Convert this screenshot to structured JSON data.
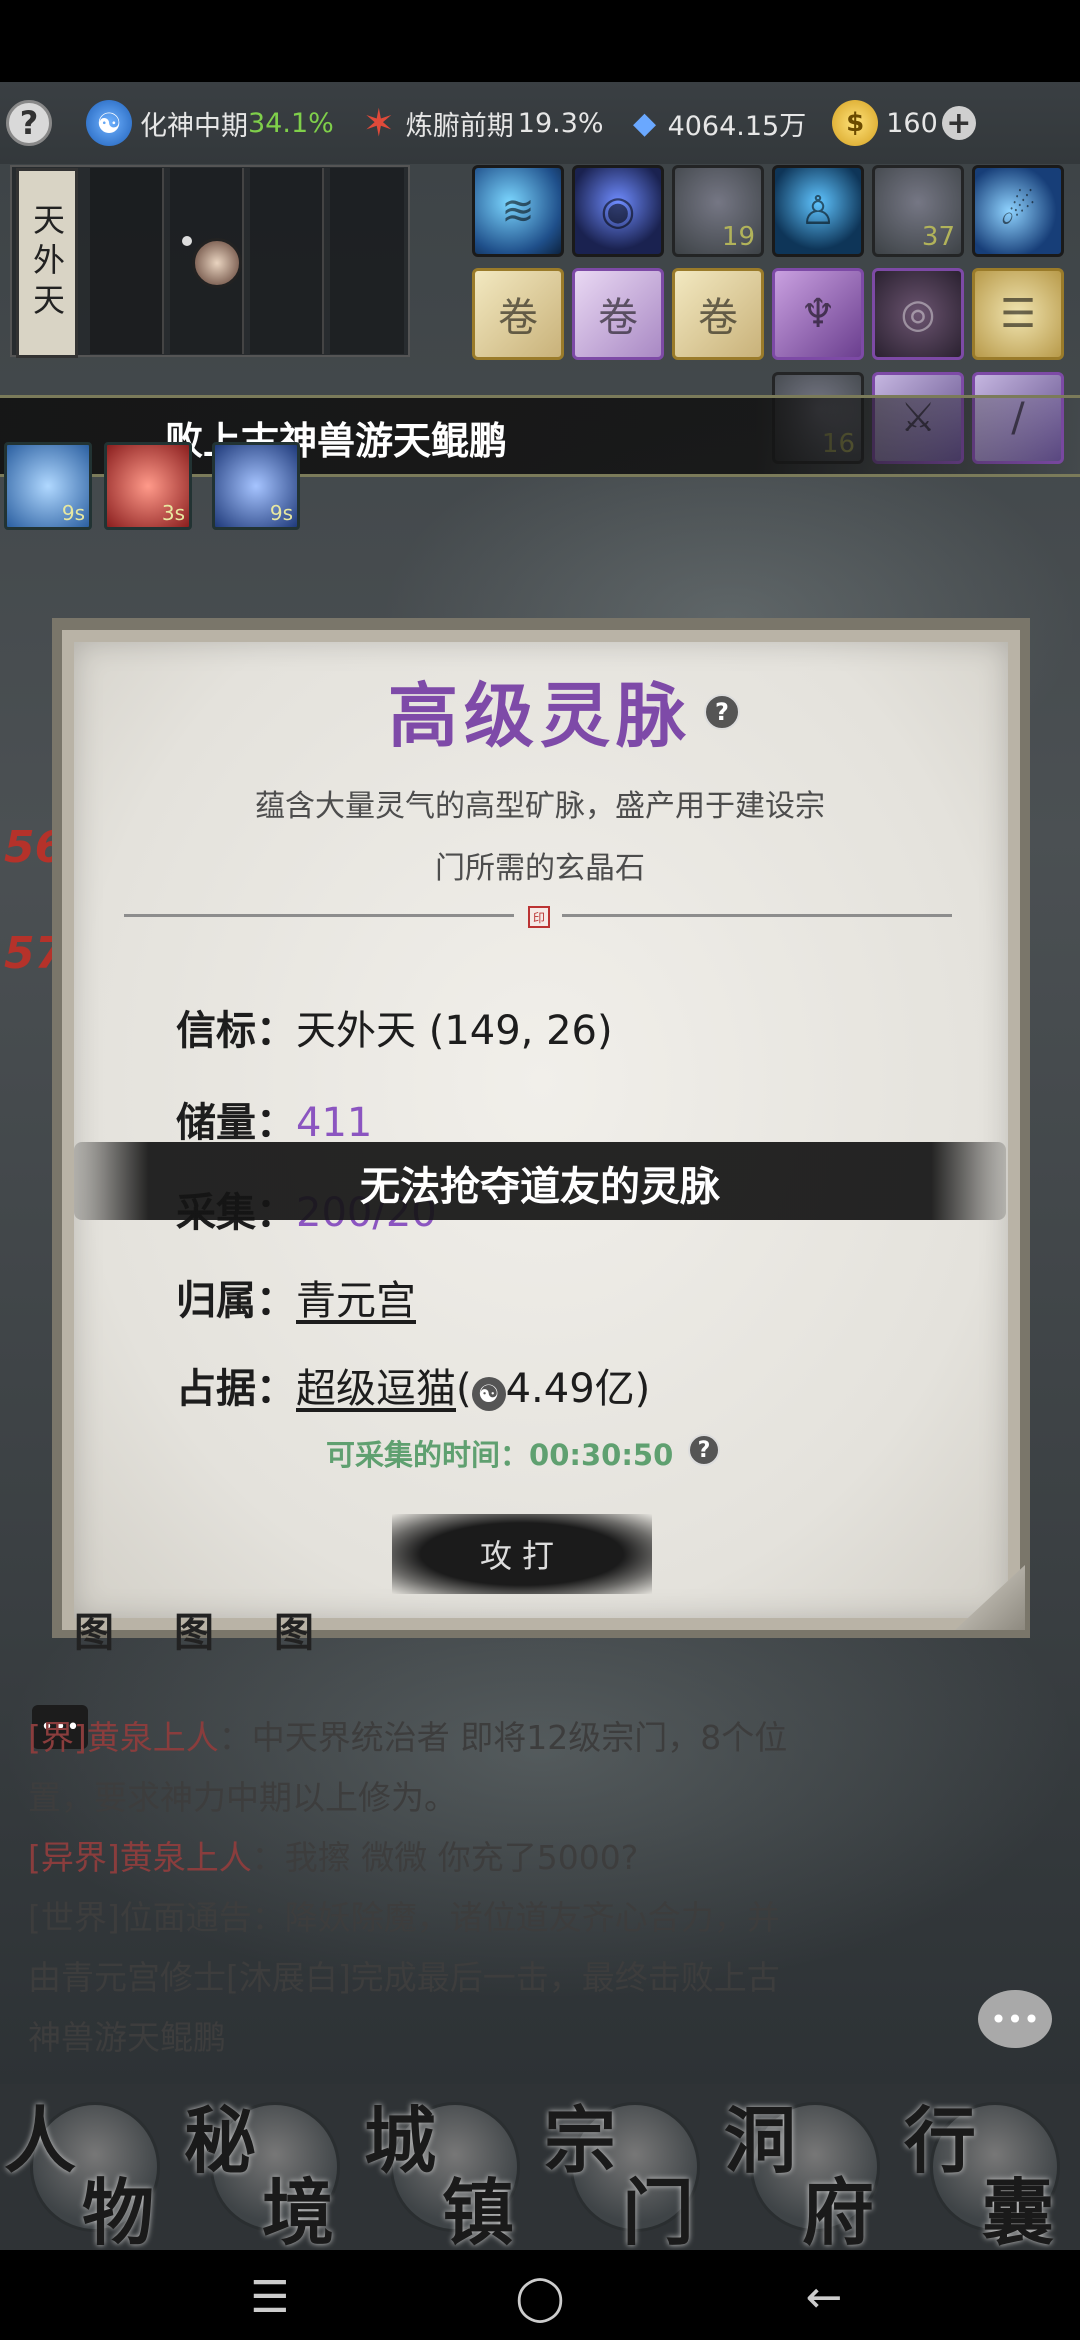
{
  "resources": {
    "realm_label": "化神中期",
    "realm_percent": "34.1%",
    "body_label": "炼腑前期",
    "body_percent": "19.3%",
    "spirit_stones": "4064.15万",
    "gold": "160",
    "help_glyph": "?",
    "plus_glyph": "+"
  },
  "sect_title": "天外天",
  "skill_counts": {
    "slot3": "19",
    "slot5": "37",
    "slot_bag1": "16"
  },
  "banner": "败上古神兽游天鲲鹏",
  "buffs": [
    {
      "time": "9s"
    },
    {
      "time": "3s"
    },
    {
      "time": "9s"
    }
  ],
  "side_numbers": [
    "56",
    "57"
  ],
  "modal": {
    "title": "高级灵脉",
    "description_line1": "蕴含大量灵气的高型矿脉，盛产用于建设宗",
    "description_line2": "门所需的玄晶石",
    "rows": {
      "beacon_label": "信标：",
      "beacon_value": "天外天 (149, 26)",
      "reserve_label": "储量：",
      "reserve_value": "411",
      "collect_label": "采集：",
      "collect_value": "200/20",
      "owner_label": "归属：",
      "owner_value": "青元宫",
      "occupy_label": "占据：",
      "occupy_value": "超级逗猫",
      "occupy_power": "4.49亿)"
    },
    "timer_label": "可采集的时间：",
    "timer_value": "00:30:50",
    "attack_button": "攻打",
    "help_glyph": "?"
  },
  "toast": "无法抢夺道友的灵脉",
  "chat": {
    "lines": [
      {
        "prefix": "[",
        "channel": "界]黄泉上人",
        "text": "：中天界统治者 即将12级宗门，8个位"
      },
      {
        "prefix": "",
        "channel": "",
        "text": "置，要求神力中期以上修为。"
      },
      {
        "prefix": "",
        "channel": "[异界]黄泉上人",
        "text": "：我擦 微微 你充了5000?"
      },
      {
        "prefix": "",
        "channel": "",
        "text": "[世界]位面通告：降妖除魔，诸位道友齐心合力，并"
      },
      {
        "prefix": "",
        "channel": "",
        "text": "由青元宫修士[沐展白]完成最后一击，最终击败上古"
      },
      {
        "prefix": "",
        "channel": "",
        "text": "神兽游天鲲鹏"
      }
    ],
    "behind_modal": [
      "图",
      "图",
      "图"
    ]
  },
  "nav": [
    {
      "c1": "人",
      "c2": "物"
    },
    {
      "c1": "秘",
      "c2": "境"
    },
    {
      "c1": "城",
      "c2": "镇"
    },
    {
      "c1": "宗",
      "c2": "门"
    },
    {
      "c1": "洞",
      "c2": "府"
    },
    {
      "c1": "行",
      "c2": "囊"
    }
  ],
  "system_nav": {
    "menu": "☰",
    "home": "◯",
    "back": "←"
  }
}
